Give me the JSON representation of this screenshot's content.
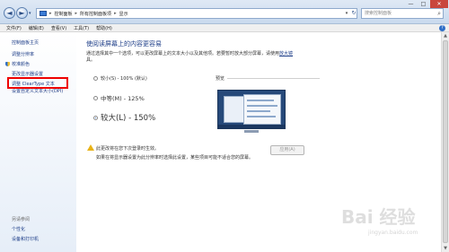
{
  "address_bar": {
    "recent": "▾",
    "breadcrumb": [
      "控制面板",
      "所有控制面板项",
      "显示"
    ],
    "search_placeholder": "搜索控制面板"
  },
  "window_controls": {
    "minimize": "—",
    "maximize": "□",
    "close": "✕"
  },
  "menu": [
    "文件(F)",
    "编辑(E)",
    "查看(V)",
    "工具(T)",
    "帮助(H)"
  ],
  "help": "?",
  "sidebar": {
    "items": [
      {
        "label": "控制面板主页"
      },
      {
        "label": "调整分辨率"
      },
      {
        "label": "校准颜色"
      },
      {
        "label": "更改显示器设置"
      },
      {
        "label": "调整 ClearType 文本"
      },
      {
        "label": "设置自定义文本大小(DPI)"
      }
    ],
    "see_also_title": "另请参阅",
    "see_also": [
      {
        "label": "个性化"
      },
      {
        "label": "设备和打印机"
      }
    ]
  },
  "main": {
    "title": "使阅读屏幕上的内容更容易",
    "desc_line1_prefix": "通过选择其中一个选项，可以更改屏幕上的文本大小以及其他项。若要暂时放大部分屏幕，请使用",
    "desc_link": "放大镜",
    "desc_line2": "具。",
    "options": [
      {
        "label": "较小(S) - 100% (默认)",
        "selected": false
      },
      {
        "label": "中等(M) - 125%",
        "selected": false
      },
      {
        "label": "较大(L) - 150%",
        "selected": true
      }
    ],
    "preview_label": "预览",
    "warning_line1": "此更改将在您下次登录时生效。",
    "warning_line2": "如果在将显示器设置为此分辨率时选择此设置，某些项目可能不适合您的屏幕。",
    "apply_button": "应用(A)"
  },
  "watermark": {
    "text": "Bai 经验",
    "url_text": "jingyan.baidu.com"
  },
  "colors": {
    "link": "#1e3e88",
    "highlight": "#ee0000",
    "close": "#c9463d"
  },
  "icons": {
    "back": "back-arrow-icon",
    "forward": "forward-arrow-icon",
    "search": "magnifier-icon",
    "shield": "uac-shield-icon",
    "warning": "warning-icon"
  }
}
